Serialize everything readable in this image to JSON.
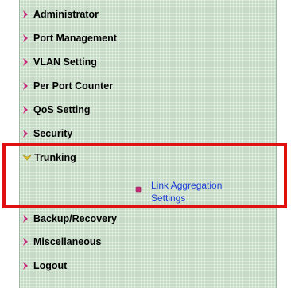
{
  "menu": {
    "items": [
      {
        "label": "Administrator",
        "icon": "arrow-right-icon"
      },
      {
        "label": "Port Management",
        "icon": "arrow-right-icon"
      },
      {
        "label": "VLAN Setting",
        "icon": "arrow-right-icon"
      },
      {
        "label": "Per Port Counter",
        "icon": "arrow-right-icon"
      },
      {
        "label": "QoS Setting",
        "icon": "arrow-right-icon"
      },
      {
        "label": "Security",
        "icon": "arrow-right-icon"
      },
      {
        "label": "Trunking",
        "icon": "arrow-down-icon",
        "expanded": true
      },
      {
        "label": "Backup/Recovery",
        "icon": "arrow-right-icon"
      },
      {
        "label": "Miscellaneous",
        "icon": "arrow-right-icon"
      },
      {
        "label": "Logout",
        "icon": "arrow-right-icon"
      }
    ],
    "sub_items": [
      {
        "label": "Link Aggregation Settings",
        "icon": "bullet-icon"
      }
    ]
  },
  "colors": {
    "panel_background": "#c6dbc6",
    "arrow": "#c8287a",
    "arrow_expanded": "#e6c21a",
    "sub_link": "#1c3fd6",
    "highlight": "#e01010"
  }
}
